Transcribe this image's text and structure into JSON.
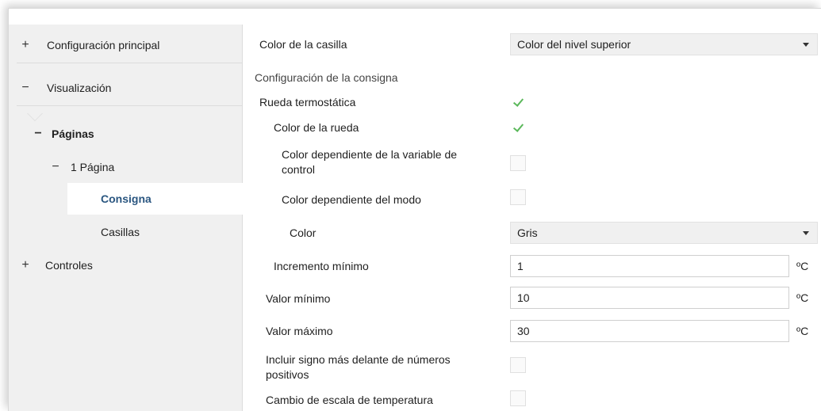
{
  "sidebar": {
    "items": [
      {
        "symbol": "+",
        "label": "Configuración principal"
      },
      {
        "symbol": "−",
        "label": "Visualización"
      },
      {
        "symbol": "−",
        "label": "Páginas"
      },
      {
        "symbol": "−",
        "label": "1 Página"
      },
      {
        "symbol": "",
        "label": "Consigna"
      },
      {
        "symbol": "",
        "label": "Casillas"
      },
      {
        "symbol": "+",
        "label": "Controles"
      }
    ]
  },
  "main": {
    "color_casilla": {
      "label": "Color de la casilla",
      "value": "Color del nivel superior"
    },
    "section_title": "Configuración de la consigna",
    "rueda_termostatica": {
      "label": "Rueda termostática",
      "checked": true
    },
    "color_rueda": {
      "label": "Color de la rueda",
      "checked": true
    },
    "color_var_control": {
      "label_line1": "Color dependiente de la variable de",
      "label_line2": "control",
      "checked": false
    },
    "color_modo": {
      "label": "Color dependiente del modo",
      "checked": false
    },
    "color": {
      "label": "Color",
      "value": "Gris"
    },
    "incremento": {
      "label": "Incremento mínimo",
      "value": "1",
      "unit": "ºC"
    },
    "valor_minimo": {
      "label": "Valor mínimo",
      "value": "10",
      "unit": "ºC"
    },
    "valor_maximo": {
      "label": "Valor máximo",
      "value": "30",
      "unit": "ºC"
    },
    "signo_mas": {
      "label_line1": "Incluir signo más delante de números",
      "label_line2": "positivos",
      "checked": false
    },
    "cambio_escala": {
      "label": "Cambio de escala de temperatura",
      "checked": false
    }
  },
  "colors": {
    "check_green": "#5bb85b",
    "sidebar_bg": "#f0f0f0",
    "selected_bg": "#ffffff"
  },
  "icons": {
    "expand": "plus-icon",
    "collapse": "minus-icon",
    "dropdown": "chevron-down-icon",
    "check": "checkmark-icon"
  }
}
